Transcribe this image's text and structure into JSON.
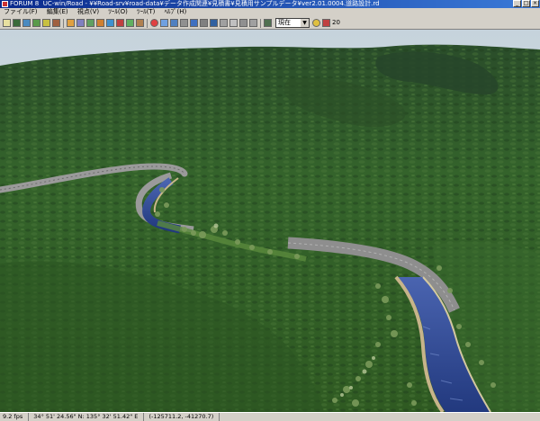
{
  "window": {
    "app_name": "FORUM 8",
    "title": "UC-win/Road  -  ¥¥Road-srv¥road-data¥データ作成関連¥見積書¥見積用サンプルデータ¥ver2.01.0004.道路設計.rd"
  },
  "menu": [
    "ファイル(F)",
    "編集(E)",
    "視点(V)",
    "ﾂｰﾙ(O)",
    "ﾂｰﾙ(T)",
    "ﾍﾙﾌﾟ(H)"
  ],
  "toolbar": {
    "time_select": "現在",
    "fps_field": "20"
  },
  "status": {
    "fps": "9.2 fps",
    "longitude": "34°  51' 24.56\"  N: 135°  32' 51.42\"  E",
    "coords": "(-125711.2, -41270.7)"
  },
  "colors": {
    "sky": "#c9d4dc",
    "terrain": "#2e5a25",
    "road": "#8a8a8a",
    "river": "#2d4a9e"
  }
}
